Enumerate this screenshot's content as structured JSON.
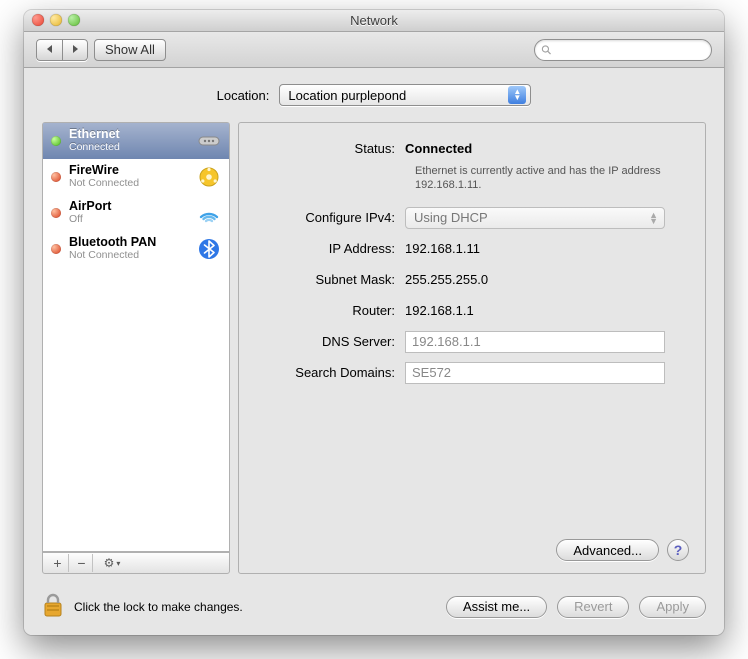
{
  "window": {
    "title": "Network"
  },
  "toolbar": {
    "back_label": "◀",
    "forward_label": "▶",
    "show_all_label": "Show All",
    "search_placeholder": ""
  },
  "location": {
    "label": "Location:",
    "selected": "Location purplepond"
  },
  "sidebar": {
    "items": [
      {
        "name": "Ethernet",
        "sub": "Connected",
        "status": "green",
        "icon": "ethernet-icon",
        "selected": true
      },
      {
        "name": "FireWire",
        "sub": "Not Connected",
        "status": "red",
        "icon": "firewire-icon",
        "selected": false
      },
      {
        "name": "AirPort",
        "sub": "Off",
        "status": "red",
        "icon": "airport-icon",
        "selected": false
      },
      {
        "name": "Bluetooth PAN",
        "sub": "Not Connected",
        "status": "red",
        "icon": "bluetooth-icon",
        "selected": false
      }
    ],
    "footer": {
      "add": "+",
      "remove": "−",
      "gear": "⚙",
      "menu": "▾"
    }
  },
  "detail": {
    "status_label": "Status:",
    "status_value": "Connected",
    "status_desc": "Ethernet is currently active and has the IP address 192.168.1.11.",
    "configure_label": "Configure IPv4:",
    "configure_value": "Using DHCP",
    "ip_label": "IP Address:",
    "ip_value": "192.168.1.11",
    "subnet_label": "Subnet Mask:",
    "subnet_value": "255.255.255.0",
    "router_label": "Router:",
    "router_value": "192.168.1.1",
    "dns_label": "DNS Server:",
    "dns_value": "192.168.1.1",
    "search_label": "Search Domains:",
    "search_value": "SE572",
    "advanced_label": "Advanced...",
    "help": "?"
  },
  "bottom": {
    "lock_text": "Click the lock to make changes.",
    "assist_label": "Assist me...",
    "revert_label": "Revert",
    "apply_label": "Apply"
  }
}
